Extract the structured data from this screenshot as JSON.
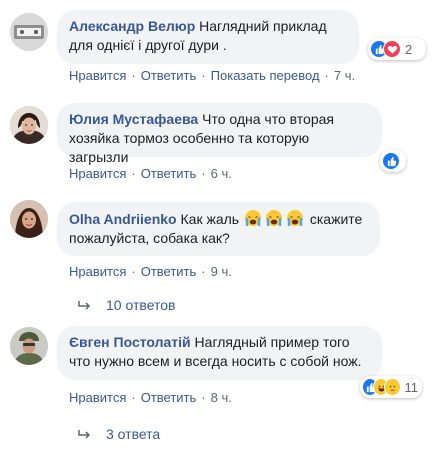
{
  "comments": [
    {
      "author": "Александр Велюр",
      "text": " Наглядний приклад для однієї і другої дури .",
      "actions": {
        "like": "Нравится",
        "reply": "Ответить",
        "translate": "Показать перевод",
        "time": "7 ч."
      },
      "reactions": {
        "icons": [
          "like-icon",
          "love-icon"
        ],
        "count": "2"
      }
    },
    {
      "author": "Юлия Мустафаева",
      "text": " Что одна что вторая хозяйка тормоз особенно та которую загрызли",
      "actions": {
        "like": "Нравится",
        "reply": "Ответить",
        "time": "6 ч."
      },
      "reactions": {
        "icons": [
          "like-icon"
        ],
        "count": ""
      }
    },
    {
      "author": "Olha Andriienko",
      "text_before": " Как жаль ",
      "emoji": [
        "crying-face-icon",
        "crying-face-icon",
        "crying-face-icon"
      ],
      "text_after": "  скажите пожалуйста, собака как?",
      "actions": {
        "like": "Нравится",
        "reply": "Ответить",
        "time": "9 ч."
      },
      "replies": "10 ответов"
    },
    {
      "author": "Євген Постолатій",
      "text": " Наглядный пример того что нужно всем и всегда носить с собой нож.",
      "actions": {
        "like": "Нравится",
        "reply": "Ответить",
        "time": "8 ч."
      },
      "reactions": {
        "icons": [
          "like-icon",
          "haha-icon",
          "sad-icon"
        ],
        "count": "11"
      },
      "replies": "3 ответа"
    }
  ],
  "separator": "·",
  "colors": {
    "link": "#385898",
    "bubble": "#f2f3f5",
    "like": "#1877f2",
    "love": "#f33e58",
    "haha": "#fcc935"
  }
}
